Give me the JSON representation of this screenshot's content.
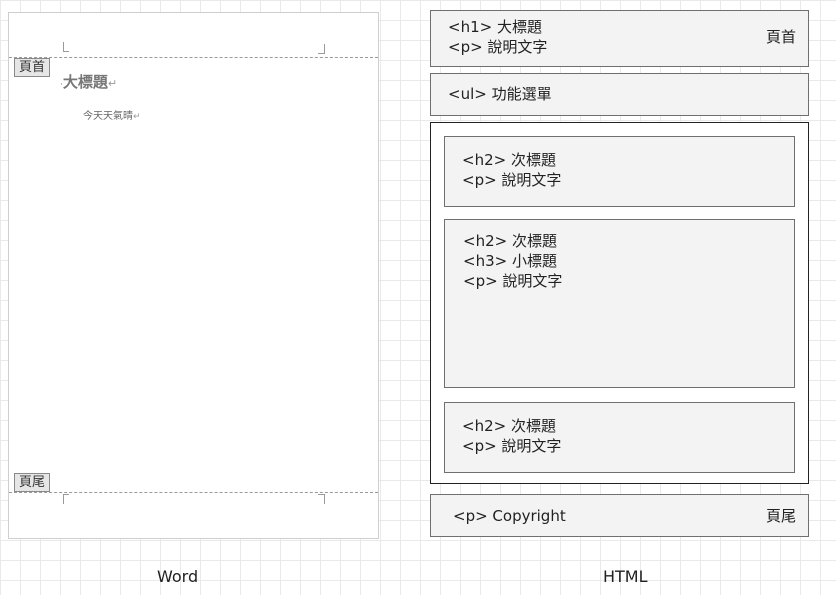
{
  "word": {
    "header_tag": "頁首",
    "footer_tag": "頁尾",
    "title": "大標題",
    "body_text": "今天天氣晴",
    "paragraph_mark": "↵",
    "caption": "Word"
  },
  "html": {
    "header_box": {
      "line1": "<h1> 大標題",
      "line2": "<p> 說明文字",
      "tag": "頁首"
    },
    "nav_box": {
      "line1": "<ul> 功能選單"
    },
    "section1": {
      "line1": "<h2> 次標題",
      "line2": "<p>  說明文字"
    },
    "section2": {
      "line1": "<h2> 次標題",
      "line2": "<h3> 小標題",
      "line3": "<p>  說明文字"
    },
    "section3": {
      "line1": "<h2> 次標題",
      "line2": "<p>  說明文字"
    },
    "footer_box": {
      "line1": "<p> Copyright",
      "tag": "頁尾"
    },
    "caption": "HTML"
  }
}
